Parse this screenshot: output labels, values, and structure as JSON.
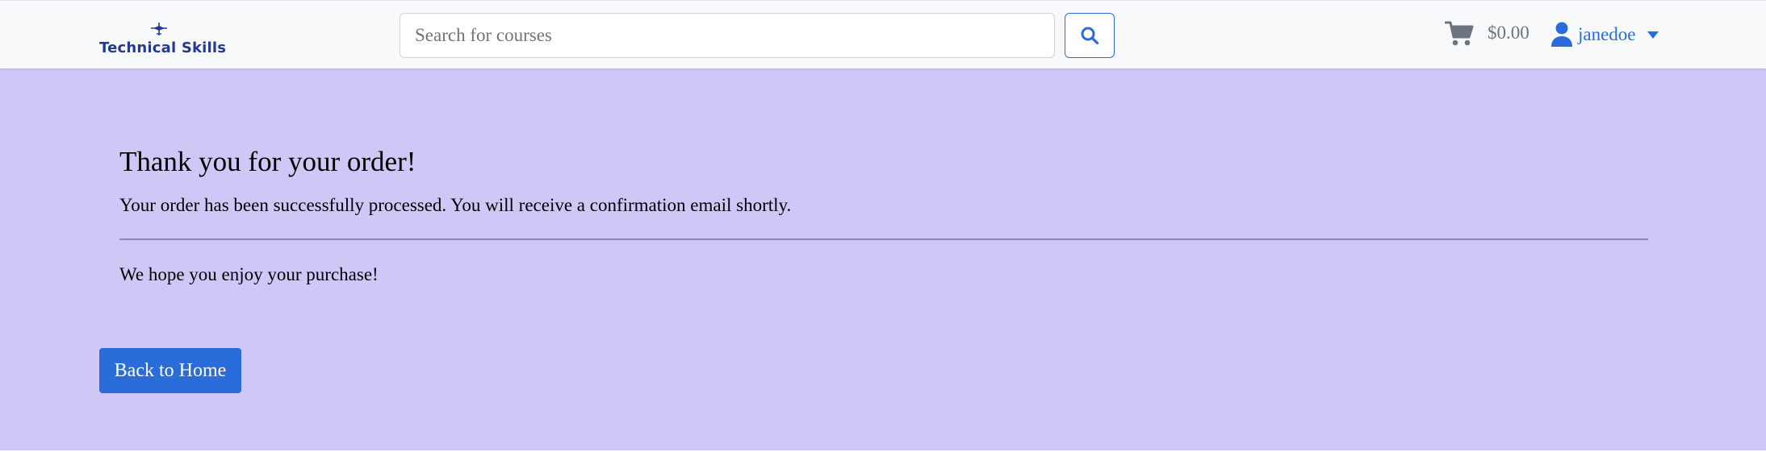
{
  "brand": {
    "name": "Technical Skills",
    "logo_icon": "plane-logo-icon"
  },
  "search": {
    "placeholder": "Search for courses",
    "value": "",
    "button_icon": "search-icon"
  },
  "cart": {
    "icon": "cart-icon",
    "total": "$0.00"
  },
  "user": {
    "icon": "user-icon",
    "username": "janedoe",
    "dropdown_icon": "caret-down-icon"
  },
  "confirmation": {
    "title": "Thank you for your order!",
    "message": "Your order has been successfully processed. You will receive a confirmation email shortly.",
    "closing": "We hope you enjoy your purchase!",
    "back_button_label": "Back to Home"
  },
  "colors": {
    "page_background": "#cfc8f7",
    "navbar_background": "#f8f9fa",
    "primary": "#2b6cdb",
    "brand_text": "#243a8f",
    "muted_text": "#6c757d"
  }
}
